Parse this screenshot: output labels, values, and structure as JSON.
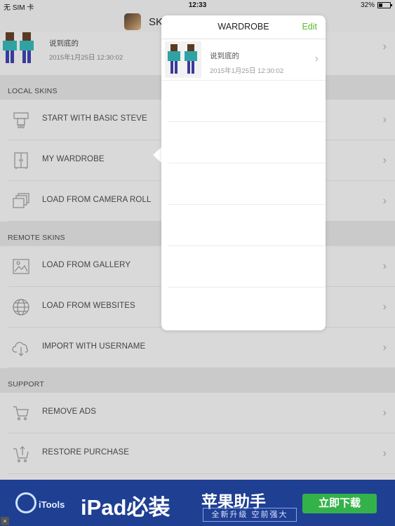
{
  "status_bar": {
    "carrier": "无 SIM 卡",
    "time": "12:33",
    "battery": "32%"
  },
  "nav": {
    "title": "SK"
  },
  "top_item": {
    "title": "说到底的",
    "date": "2015年1月25日 12:30:02"
  },
  "local_section": "LOCAL SKINS",
  "local_items": [
    {
      "label": "START WITH BASIC STEVE"
    },
    {
      "label": "MY WARDROBE"
    },
    {
      "label": "LOAD FROM CAMERA ROLL"
    }
  ],
  "remote_section": "REMOTE SKINS",
  "remote_items": [
    {
      "label": "LOAD FROM GALLERY"
    },
    {
      "label": "LOAD FROM WEBSITES"
    },
    {
      "label": "IMPORT WITH USERNAME"
    }
  ],
  "support_section": "SUPPORT",
  "support_items": [
    {
      "label": "REMOVE ADS"
    },
    {
      "label": "RESTORE PURCHASE"
    }
  ],
  "popover": {
    "title": "WARDROBE",
    "edit_label": "Edit",
    "items": [
      {
        "title": "说到底的",
        "date": "2015年1月25日 12:30:02"
      }
    ]
  },
  "ad": {
    "brand": "iTools",
    "headline": "iPad必装",
    "headline2": "苹果助手",
    "tagline": "全新升级 空前强大",
    "cta": "立即下载",
    "close": "×"
  },
  "colors": {
    "accent": "#5cba2a",
    "ad_bg": "#1f3f93",
    "cta": "#34b24a"
  }
}
